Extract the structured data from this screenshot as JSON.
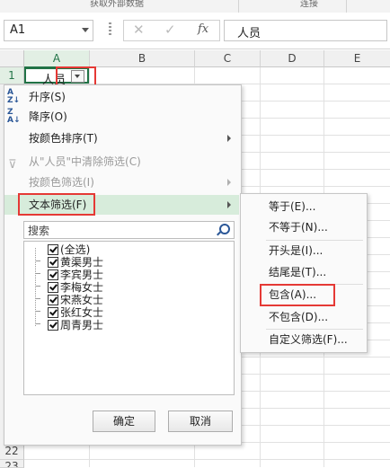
{
  "ribbon": {
    "group_get_data": "获取外部数据",
    "group_connections": "连接"
  },
  "formula_bar": {
    "name_box": "A1",
    "fx_label": "fx",
    "cancel_glyph": "✕",
    "enter_glyph": "✓",
    "value": "人员"
  },
  "grid": {
    "columns": [
      "A",
      "B",
      "C",
      "D",
      "E"
    ],
    "rows": [
      "1",
      "22",
      "23"
    ],
    "cell_a1": "人员"
  },
  "filter_menu": {
    "sort_ascending": "升序(S)",
    "sort_descending": "降序(O)",
    "sort_by_color": "按颜色排序(T)",
    "clear_filter": "从\"人员\"中清除筛选(C)",
    "filter_by_color": "按颜色筛选(I)",
    "text_filters": "文本筛选(F)",
    "search_placeholder": "搜索",
    "items": [
      {
        "label": "(全选)",
        "checked": true
      },
      {
        "label": "黄渠男士",
        "checked": true
      },
      {
        "label": "李宾男士",
        "checked": true
      },
      {
        "label": "李梅女士",
        "checked": true
      },
      {
        "label": "宋燕女士",
        "checked": true
      },
      {
        "label": "张红女士",
        "checked": true
      },
      {
        "label": "周青男士",
        "checked": true
      }
    ],
    "ok_label": "确定",
    "cancel_label": "取消"
  },
  "text_filter_submenu": {
    "equals": "等于(E)...",
    "not_equals": "不等于(N)...",
    "begins_with": "开头是(I)...",
    "ends_with": "结尾是(T)...",
    "contains": "包含(A)...",
    "not_contains": "不包含(D)...",
    "custom": "自定义筛选(F)..."
  },
  "colors": {
    "accent_green": "#217346",
    "highlight": "#d7ecdb",
    "annotation_red": "#e53935"
  }
}
